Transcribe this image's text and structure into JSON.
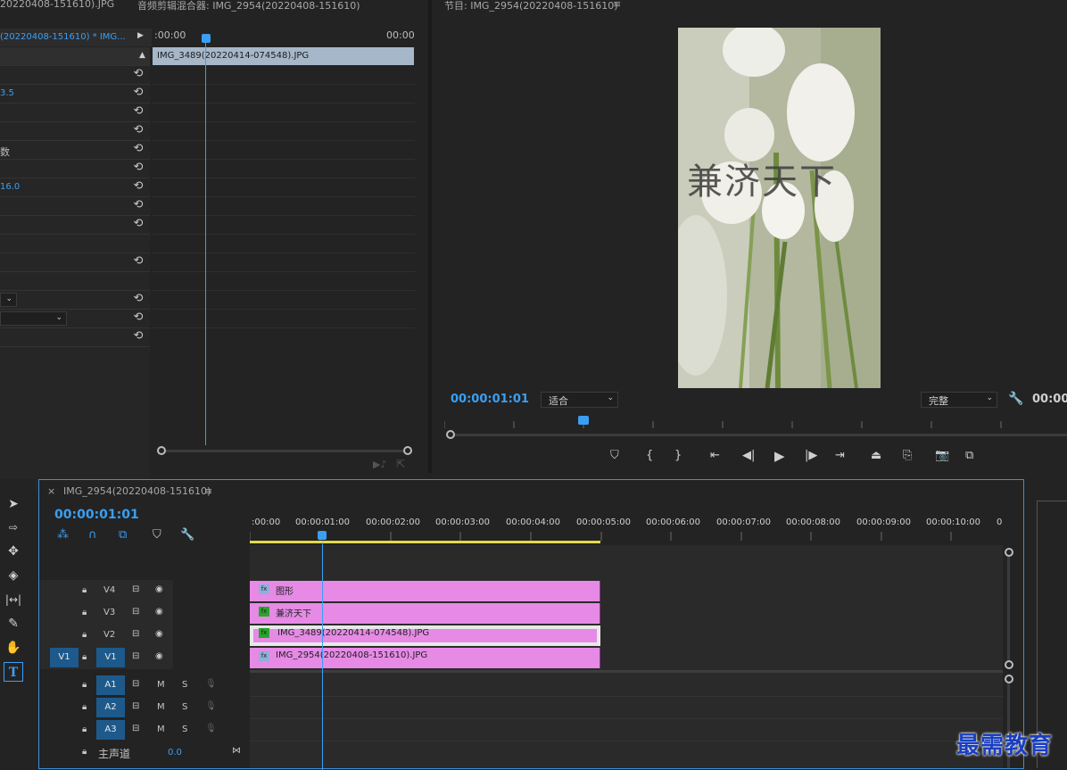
{
  "effect_controls": {
    "tab_title": "20220408-151610).JPG",
    "mixer_tab_title": "音频剪辑混合器: IMG_2954(20220408-151610)",
    "clip_selector": "(20220408-151610) * IMG...",
    "ruler_start": ":00:00",
    "ruler_end": "00:00",
    "clip_bar_name": "IMG_3489(20220414-074548).JPG",
    "rows": [
      {
        "text": "",
        "kind": "header"
      },
      {
        "text": "",
        "kind": "reset"
      },
      {
        "text": "3.5",
        "kind": "value"
      },
      {
        "text": "",
        "kind": "reset"
      },
      {
        "text": "",
        "kind": "reset"
      },
      {
        "text": "数",
        "kind": "plain"
      },
      {
        "text": "",
        "kind": "reset"
      },
      {
        "text": "16.0",
        "kind": "value"
      },
      {
        "text": "",
        "kind": "reset"
      },
      {
        "text": "",
        "kind": "reset"
      },
      {
        "text": "",
        "kind": "none"
      },
      {
        "text": "",
        "kind": "reset"
      },
      {
        "text": "",
        "kind": "none"
      },
      {
        "text": "",
        "kind": "dropdown-reset"
      },
      {
        "text": "",
        "kind": "dropdown-reset"
      },
      {
        "text": "",
        "kind": "reset"
      }
    ],
    "reset_icon": "reset-icon"
  },
  "program_monitor": {
    "title": "节目: IMG_2954(20220408-151610)",
    "menu_icon": "≡",
    "timecode": "00:00:01:01",
    "fit_value": "适合",
    "quality_value": "完整",
    "duration_right": "00:00:",
    "overlay_text": "兼济天下",
    "transport_icons": [
      "marker-icon",
      "mark-in-icon",
      "mark-out-icon",
      "go-to-in-icon",
      "step-back-icon",
      "play-icon",
      "step-forward-icon",
      "go-to-out-icon",
      "lift-icon",
      "extract-icon",
      "export-frame-icon",
      "compare-icon"
    ]
  },
  "timeline": {
    "close": "×",
    "sequence_name": "IMG_2954(20220408-151610)",
    "menu_icon": "≡",
    "timecode": "00:00:01:01",
    "ruler_labels": [
      ":00:00",
      "00:00:01:00",
      "00:00:02:00",
      "00:00:03:00",
      "00:00:04:00",
      "00:00:05:00",
      "00:00:06:00",
      "00:00:07:00",
      "00:00:08:00",
      "00:00:09:00",
      "00:00:10:00",
      "0"
    ],
    "video_tracks": [
      {
        "name": "V4",
        "source": "",
        "clip": "图形",
        "badge": "fx",
        "badge_color": "#8fb0d8"
      },
      {
        "name": "V3",
        "source": "",
        "clip": "兼济天下",
        "badge": "fx",
        "badge_color": "#2aa52a"
      },
      {
        "name": "V2",
        "source": "",
        "clip": "IMG_3489(20220414-074548).JPG",
        "badge": "fx",
        "badge_color": "#2aa52a"
      },
      {
        "name": "V1",
        "source": "V1",
        "clip": "IMG_2954(20220408-151610).JPG",
        "badge": "fx",
        "badge_color": "#8fb0d8"
      }
    ],
    "audio_tracks": [
      {
        "name": "A1",
        "m": "M",
        "s": "S"
      },
      {
        "name": "A2",
        "m": "M",
        "s": "S"
      },
      {
        "name": "A3",
        "m": "M",
        "s": "S"
      }
    ],
    "master_label": "主声道",
    "master_value": "0.0"
  },
  "tools": [
    "selection-tool-icon",
    "track-select-icon",
    "ripple-edit-icon",
    "razor-icon",
    "slip-icon",
    "pen-icon",
    "hand-icon",
    "type-tool-icon"
  ],
  "watermark": "最需教育",
  "colors": {
    "accent_blue": "#3a9ff3",
    "clip_pink": "#e68ae6",
    "active_track_blue": "#1d5a8b",
    "work_area_yellow": "#e4d94a",
    "clip_bar": "#a6b7c9"
  }
}
